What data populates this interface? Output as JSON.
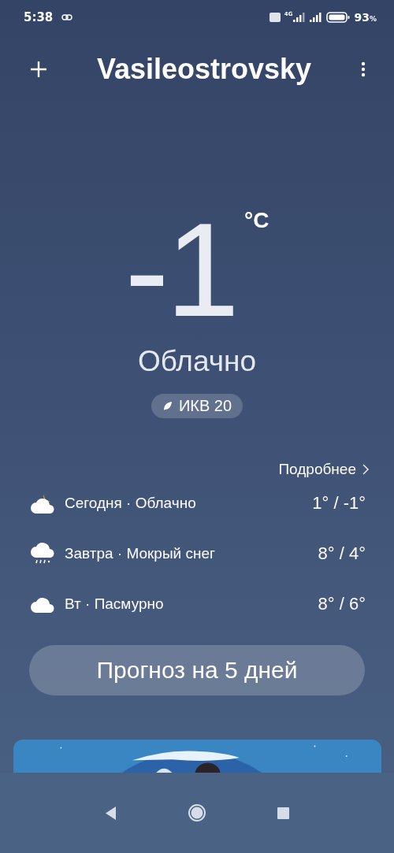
{
  "status_bar": {
    "time": "5:38",
    "network": "4G",
    "battery_level": "93",
    "battery_unit": "%"
  },
  "header": {
    "city": "Vasileostrovsky"
  },
  "current": {
    "temperature": "-1",
    "unit": "°C",
    "condition": "Облачно",
    "aqi": "ИКВ 20"
  },
  "details_link": "Подробнее",
  "forecast": [
    {
      "kind": "cloudy-night",
      "label": "Сегодня · Облачно",
      "range": "1° / -1°"
    },
    {
      "kind": "sleet",
      "label": "Завтра · Мокрый снег",
      "range": "8° / 4°"
    },
    {
      "kind": "overcast",
      "label": "Вт · Пасмурно",
      "range": "8° / 6°"
    }
  ],
  "forecast_button": "Прогноз на 5 дней"
}
